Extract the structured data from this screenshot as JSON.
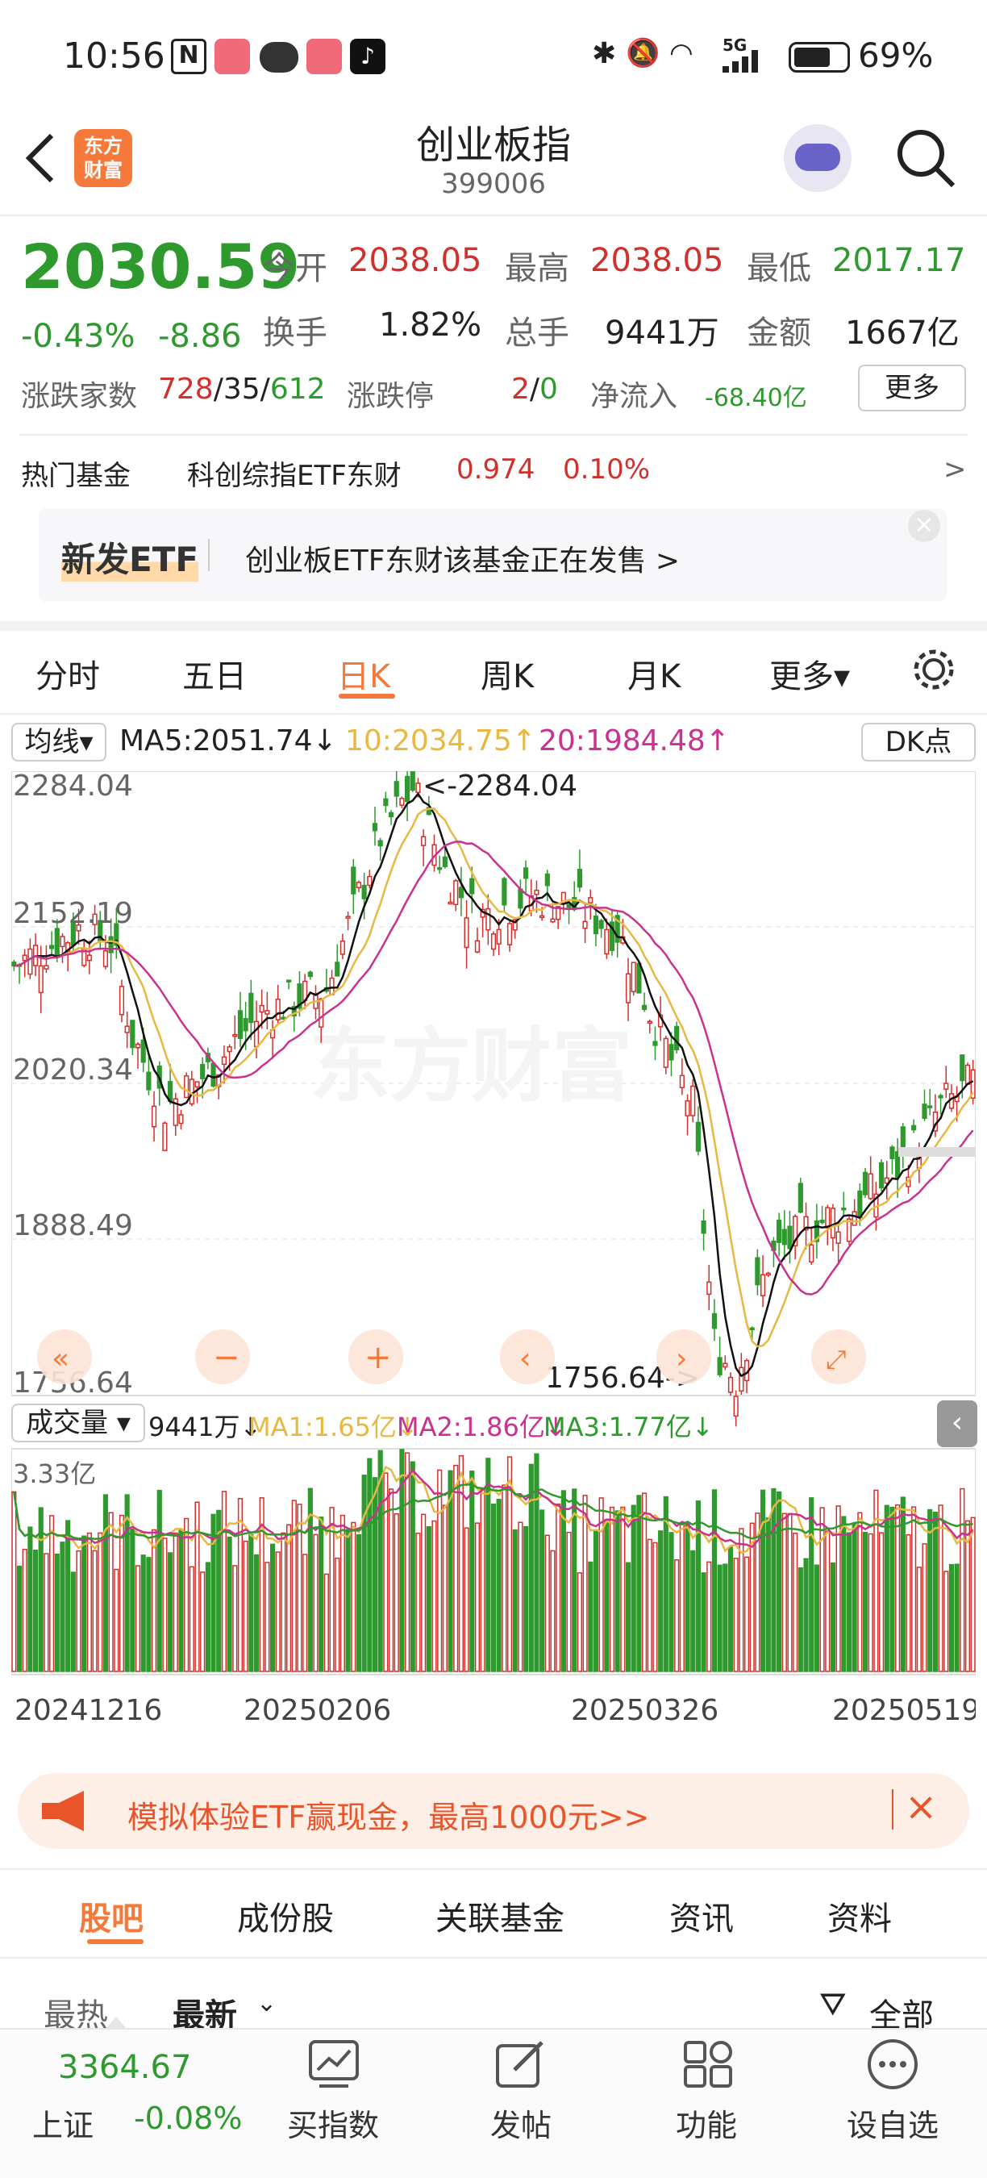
{
  "status": {
    "time": "10:56",
    "battery": "69%",
    "network": "5G"
  },
  "header": {
    "title": "创业板指",
    "code": "399006",
    "logo_line1": "东方",
    "logo_line2": "财富"
  },
  "quote": {
    "price": "2030.59",
    "pct": "-0.43%",
    "chg": "-8.86",
    "open_label": "今开",
    "open": "2038.05",
    "high_label": "最高",
    "high": "2038.05",
    "low_label": "最低",
    "low": "2017.17",
    "turnover_label": "换手",
    "turnover": "1.82%",
    "volume_label": "总手",
    "volume": "9441万",
    "amount_label": "金额",
    "amount": "1667亿",
    "breadth_label": "涨跌家数",
    "up": "728",
    "flat": "35",
    "down": "612",
    "sep": "/",
    "limit_label": "涨跌停",
    "limit_up": "2",
    "limit_down": "0",
    "inflow_label": "净流入",
    "inflow": "-68.40亿",
    "more": "更多"
  },
  "hotfund": {
    "label": "热门基金",
    "name": "科创综指ETF东财",
    "price": "0.974",
    "pct": "0.10%",
    "arrow": ">"
  },
  "banner": {
    "tag": "新发ETF",
    "text": "创业板ETF东财该基金正在发售 >",
    "close": "×"
  },
  "tabs": [
    "分时",
    "五日",
    "日K",
    "周K",
    "月K",
    "更多▾"
  ],
  "ma": {
    "select": "均线▾",
    "ma5": "MA5:2051.74↓",
    "ma10": "10:2034.75↑",
    "ma20": "20:1984.48↑",
    "dk": "DK点"
  },
  "axis": {
    "y1": "2284.04",
    "y2": "2152.19",
    "y3": "2020.34",
    "y4": "1888.49",
    "y5": "1756.64",
    "high_note": "<-2284.04",
    "low_note": "1756.64->",
    "watermark": "东方财富"
  },
  "vol": {
    "select": "成交量 ▾",
    "v": "9441万↓",
    "ma1": "MA1:1.65亿↓",
    "ma2": "MA2:1.86亿↓",
    "ma3": "MA3:1.77亿↓",
    "ymax": "3.33亿"
  },
  "dates": [
    "20241216",
    "20250206",
    "20250326",
    "20250519"
  ],
  "ad": {
    "text": "模拟体验ETF赢现金，最高1000元>>"
  },
  "subtabs": [
    "股吧",
    "成份股",
    "关联基金",
    "资讯",
    "资料"
  ],
  "sort": {
    "hot": "最热",
    "new": "最新",
    "all": "全部"
  },
  "bottom": {
    "index_value": "3364.67",
    "index_name": "上证",
    "index_pct": "-0.08%",
    "buy": "买指数",
    "post": "发帖",
    "func": "功能",
    "watch": "设自选"
  },
  "colors": {
    "up": "#d0312d",
    "down": "#2e9a2e",
    "accent": "#f5793a"
  }
}
